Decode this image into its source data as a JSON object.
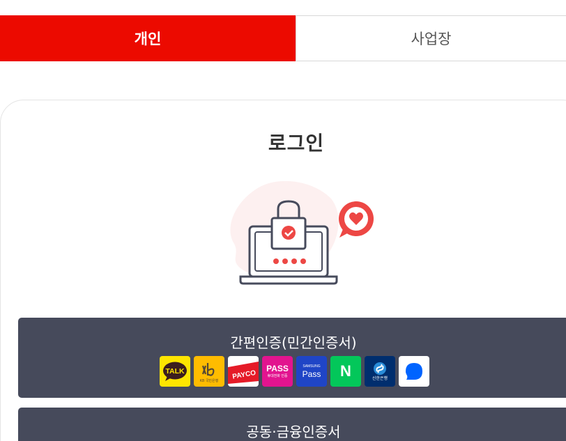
{
  "tabs": [
    {
      "label": "개인",
      "active": true
    },
    {
      "label": "사업장",
      "active": false
    }
  ],
  "login": {
    "title": "로그인"
  },
  "illustration": {
    "icons": [
      "laptop-icon",
      "padlock-icon",
      "check-icon",
      "heart-chat-icon"
    ]
  },
  "simple_auth": {
    "label": "간편인증(민간인증서)",
    "providers": [
      {
        "name": "kakao",
        "icon": "kakao-talk-icon",
        "text": "TALK",
        "bg": "#fee500"
      },
      {
        "name": "kb",
        "icon": "kb-bank-icon",
        "text": "KB 국민은행",
        "bg": "#ffbc00"
      },
      {
        "name": "payco",
        "icon": "payco-icon",
        "text": "PAYCO",
        "bg": "#ffffff"
      },
      {
        "name": "pass",
        "icon": "pass-icon",
        "text": "PASS",
        "sub": "휴대전화 인증",
        "bg": "#e2148f"
      },
      {
        "name": "samsung-pass",
        "icon": "samsung-pass-icon",
        "text": "Pass",
        "sub": "SAMSUNG",
        "bg": "#1f45c6"
      },
      {
        "name": "naver",
        "icon": "naver-icon",
        "text": "N",
        "bg": "#03c75a"
      },
      {
        "name": "shinhan",
        "icon": "shinhan-bank-icon",
        "text": "신한은행",
        "bg": "#002e6e"
      },
      {
        "name": "toss",
        "icon": "toss-icon",
        "bg": "#ffffff"
      }
    ]
  },
  "joint_auth": {
    "label": "공동·금융인증서"
  },
  "colors": {
    "accent": "#ec0a00",
    "button_bg": "#464a5b",
    "title_text": "#333333"
  }
}
